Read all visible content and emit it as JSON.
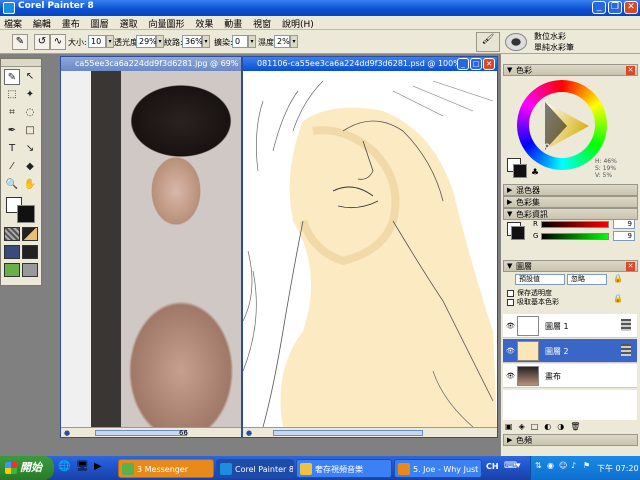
{
  "window": {
    "title": "Corel Painter 8",
    "minimize": "_",
    "restore": "❐",
    "close": "✕"
  },
  "menu": [
    "檔案",
    "編輯",
    "畫布",
    "圖層",
    "選取",
    "向量圖形",
    "效果",
    "動畫",
    "視窗",
    "說明(H)"
  ],
  "propbar": {
    "size_label": "大小:",
    "size_value": "10",
    "opacity_label": "透光度:",
    "opacity_value": "29%",
    "grain_label": "紋路:",
    "grain_value": "36%",
    "bleed_label": "擴染:",
    "bleed_value": "0",
    "wet_label": "濕度:",
    "wet_value": "2%",
    "brush_category": "數位水彩",
    "brush_variant": "單純水彩筆"
  },
  "doc1": {
    "title": "ca55ee3ca6a224dd9f3d6281.jpg @ 69%",
    "status": "66"
  },
  "doc2": {
    "title": "081106-ca55ee3ca6a224dd9f3d6281.psd @ 100%"
  },
  "color_panel": {
    "title": "色彩",
    "h": "H: 46%",
    "s": "S: 19%",
    "v": "V: 5%"
  },
  "mixer_panel": {
    "title": "混色器"
  },
  "colorset_panel": {
    "title": "色彩集"
  },
  "colorinfo_panel": {
    "title": "色彩資訊",
    "r_label": "R",
    "r_value": "9",
    "g_label": "G",
    "g_value": "9"
  },
  "layers_panel": {
    "title": "圖層",
    "composite_method": "預設值",
    "composite_depth": "忽略",
    "preserve_transparency": "保存透明度",
    "pick_up_color": "吸取基本色彩",
    "layers": [
      {
        "name": "圖層 1"
      },
      {
        "name": "圖層 2"
      },
      {
        "name": "畫布"
      }
    ]
  },
  "channels_panel": {
    "title": "色頻"
  },
  "taskbar": {
    "start": "開始",
    "tasks": [
      "3 Messenger",
      "Corel Painter 8",
      "奢存視頻音樂",
      "5. Joe - Why Just B..."
    ],
    "lang": "CH",
    "clock": "下午 07:20"
  }
}
